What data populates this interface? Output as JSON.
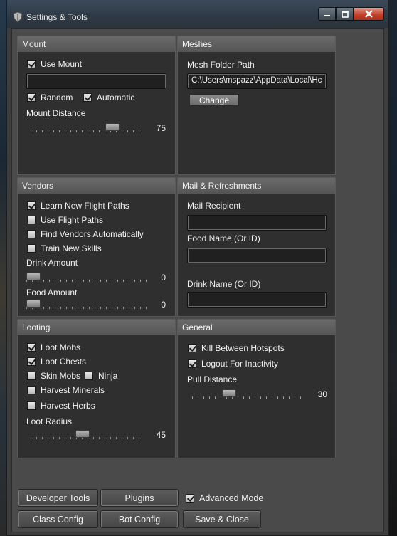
{
  "window": {
    "title": "Settings & Tools",
    "icon": "shield-icon"
  },
  "titlebar_buttons": {
    "minimize": "minimize-icon",
    "maximize": "maximize-icon",
    "close": "close-icon"
  },
  "mount": {
    "header": "Mount",
    "use_mount": {
      "label": "Use Mount",
      "checked": true
    },
    "mount_name": "",
    "random": {
      "label": "Random",
      "checked": true
    },
    "automatic": {
      "label": "Automatic",
      "checked": true
    },
    "distance_label": "Mount Distance",
    "distance_value": "75",
    "distance_fraction": 0.75
  },
  "meshes": {
    "header": "Meshes",
    "folder_label": "Mesh Folder Path",
    "folder_value": "C:\\Users\\mspazz\\AppData\\Local\\Hc",
    "change_button": "Change"
  },
  "vendors": {
    "header": "Vendors",
    "options": [
      {
        "label": "Learn New Flight Paths",
        "checked": true
      },
      {
        "label": "Use Flight Paths",
        "checked": false
      },
      {
        "label": "Find Vendors Automatically",
        "checked": false
      },
      {
        "label": "Train New Skills",
        "checked": false
      }
    ],
    "drink_label": "Drink Amount",
    "drink_value": "0",
    "food_label": "Food Amount",
    "food_value": "0"
  },
  "mail": {
    "header": "Mail & Refreshments",
    "recipient_label": "Mail Recipient",
    "recipient_value": "",
    "food_label": "Food Name (Or ID)",
    "food_value": "",
    "drink_label": "Drink Name (Or ID)",
    "drink_value": ""
  },
  "looting": {
    "header": "Looting",
    "loot_mobs": {
      "label": "Loot Mobs",
      "checked": true
    },
    "loot_chests": {
      "label": "Loot Chests",
      "checked": true
    },
    "skin_mobs": {
      "label": "Skin Mobs",
      "checked": false
    },
    "ninja": {
      "label": "Ninja",
      "checked": false
    },
    "harvest_minerals": {
      "label": "Harvest Minerals",
      "checked": false
    },
    "harvest_herbs": {
      "label": "Harvest Herbs",
      "checked": false
    },
    "radius_label": "Loot Radius",
    "radius_value": "45",
    "radius_fraction": 0.45
  },
  "general": {
    "header": "General",
    "kill_between": {
      "label": "Kill Between Hotspots",
      "checked": true
    },
    "logout_inactivity": {
      "label": "Logout For Inactivity",
      "checked": true
    },
    "pull_label": "Pull Distance",
    "pull_value": "30",
    "pull_fraction": 0.3
  },
  "footer": {
    "developer_tools": "Developer Tools",
    "plugins": "Plugins",
    "advanced_mode": {
      "label": "Advanced Mode",
      "checked": true
    },
    "class_config": "Class Config",
    "bot_config": "Bot Config",
    "save_close": "Save & Close"
  }
}
